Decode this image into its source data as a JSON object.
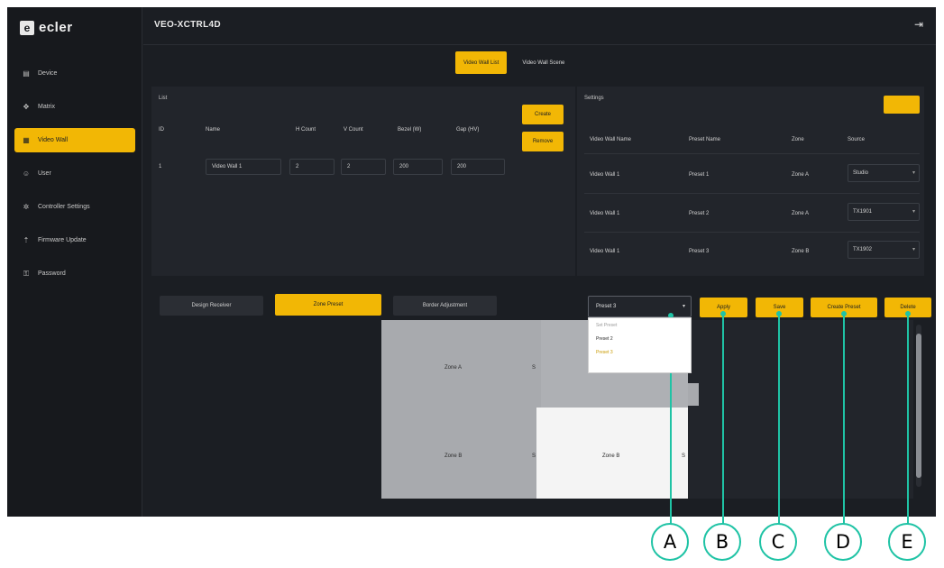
{
  "brand": {
    "logo_text": "ecler"
  },
  "header": {
    "title": "VEO-XCTRL4D",
    "logout_icon": "logout-icon"
  },
  "sidebar": {
    "items": [
      {
        "label": "Device",
        "icon": "device-icon"
      },
      {
        "label": "Matrix",
        "icon": "matrix-icon"
      },
      {
        "label": "Video Wall",
        "icon": "video-wall-icon",
        "active": true
      },
      {
        "label": "User",
        "icon": "user-icon"
      },
      {
        "label": "Controller Settings",
        "icon": "settings-icon"
      },
      {
        "label": "Firmware Update",
        "icon": "firmware-icon"
      },
      {
        "label": "Password",
        "icon": "password-icon"
      }
    ]
  },
  "tabs": [
    {
      "label": "Video Wall List",
      "active": true
    },
    {
      "label": "Video Wall Scene",
      "active": false
    }
  ],
  "list_panel": {
    "label": "List",
    "headers": [
      "ID",
      "Name",
      "H Count",
      "V Count",
      "Bezel (W)",
      "Gap (HV)"
    ],
    "rows": [
      {
        "id": "1",
        "name": "Video Wall 1",
        "h": "2",
        "v": "2",
        "bezel": "200",
        "gap": "200"
      }
    ],
    "create_label": "Create",
    "remove_label": "Remove"
  },
  "settings_panel": {
    "label": "Settings",
    "action_label": "",
    "headers": [
      "Video Wall Name",
      "Preset Name",
      "Zone",
      "Source"
    ],
    "rows": [
      {
        "wall": "Video Wall 1",
        "preset": "Preset 1",
        "zone": "Zone A",
        "source": "Studio"
      },
      {
        "wall": "Video Wall 1",
        "preset": "Preset 2",
        "zone": "Zone A",
        "source": "TX1901"
      },
      {
        "wall": "Video Wall 1",
        "preset": "Preset 3",
        "zone": "Zone B",
        "source": "TX1902"
      }
    ]
  },
  "design": {
    "buttons": [
      "Design Receiver",
      "Zone Preset",
      "Border Adjustment"
    ],
    "active_index": 1,
    "preset_select": {
      "value": "Preset 3",
      "options": [
        "Set Preset",
        "Preset 2",
        "Preset 3"
      ]
    },
    "apply_label": "Apply",
    "save_label": "Save",
    "create_preset_label": "Create Preset",
    "delete_label": "Delete",
    "zones": [
      "Zone A",
      "Zone B",
      "Zone B"
    ],
    "zone_markers": [
      "S",
      "S",
      "S"
    ]
  },
  "callouts": [
    "A",
    "B",
    "C",
    "D",
    "E"
  ],
  "colors": {
    "accent": "#f2b705",
    "callout": "#1fc3a5",
    "background": "#1b1e23"
  }
}
